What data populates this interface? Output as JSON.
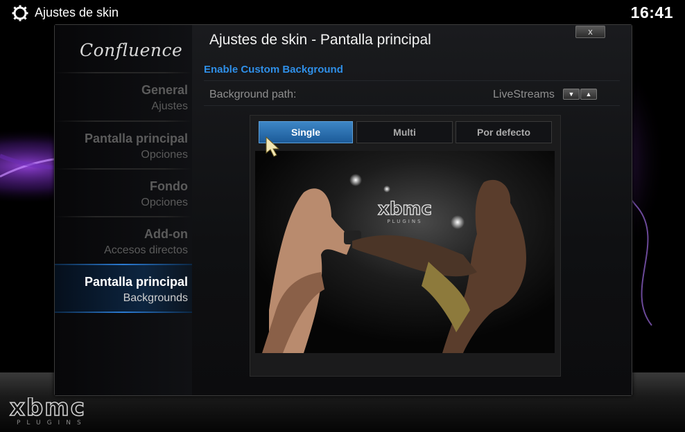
{
  "header": {
    "title": "Ajustes de skin",
    "time": "16:41",
    "icon": "gear-icon"
  },
  "dialog": {
    "title": "Ajustes de skin - Pantalla principal",
    "close_label": "x",
    "logo": "Confluence"
  },
  "menu": [
    {
      "main": "General",
      "sub": "Ajustes",
      "active": false
    },
    {
      "main": "Pantalla principal",
      "sub": "Opciones",
      "active": false
    },
    {
      "main": "Fondo",
      "sub": "Opciones",
      "active": false
    },
    {
      "main": "Add-on",
      "sub": "Accesos directos",
      "active": false
    },
    {
      "main": "Pantalla principal",
      "sub": "Backgrounds",
      "active": true
    }
  ],
  "settings": {
    "enable_label": "Enable Custom Background",
    "path_label": "Background path:",
    "path_value": "LiveStreams",
    "spin_down": "▼",
    "spin_up": "▲"
  },
  "tabs": [
    {
      "label": "Single",
      "active": true
    },
    {
      "label": "Multi",
      "active": false
    },
    {
      "label": "Por defecto",
      "active": false
    }
  ],
  "preview": {
    "watermark": "xbmc",
    "watermark_sub": "PLUGINS",
    "image": "mma-fighters-photo"
  },
  "footer_logo": {
    "text": "xbmc",
    "sub": "PLUGINS"
  },
  "colors": {
    "accent": "#2f8fe8",
    "active_tab": "#2a6fb0",
    "smoke": "#7a3fd0"
  }
}
